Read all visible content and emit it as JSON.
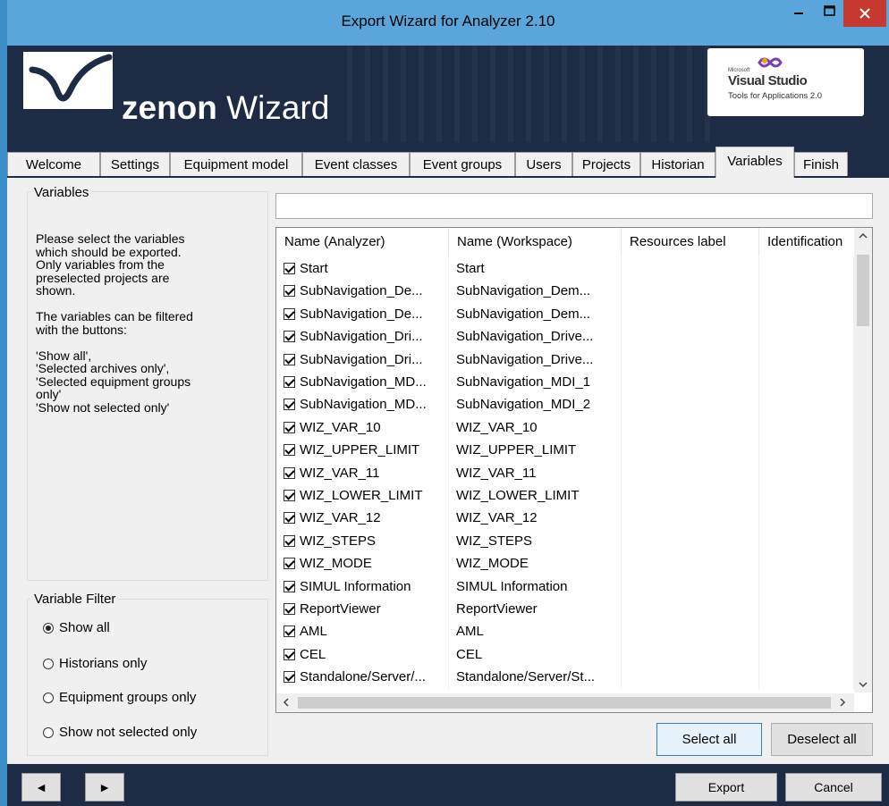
{
  "window": {
    "title": "Export Wizard for Analyzer 2.10",
    "controls": {
      "minimize": "–",
      "maximize": "□",
      "close": "✕"
    }
  },
  "banner": {
    "brand_bold": "zenon",
    "brand_rest": " Wizard",
    "vs_microsoft": "Microsoft",
    "vs_title": "Visual Studio",
    "vs_sub": "Tools for Applications 2.0"
  },
  "tabs": [
    {
      "label": "Welcome"
    },
    {
      "label": "Settings"
    },
    {
      "label": "Equipment model"
    },
    {
      "label": "Event classes"
    },
    {
      "label": "Event groups"
    },
    {
      "label": "Users"
    },
    {
      "label": "Projects"
    },
    {
      "label": "Historian"
    },
    {
      "label": "Variables",
      "active": true
    },
    {
      "label": "Finish"
    }
  ],
  "left": {
    "variables_legend": "Variables",
    "description": "Please select the variables\nwhich should be exported.\nOnly variables from the\npreselected projects are\nshown.\n\nThe variables can be filtered\nwith the buttons:\n\n'Show all',\n'Selected archives only',\n'Selected equipment groups\nonly'\n'Show not selected only'",
    "filter_legend": "Variable Filter",
    "filter_options": [
      {
        "label": "Show all",
        "checked": true
      },
      {
        "label": "Historians only",
        "checked": false
      },
      {
        "label": "Equipment groups only",
        "checked": false
      },
      {
        "label": "Show not selected only",
        "checked": false
      }
    ]
  },
  "filter_input": {
    "value": ""
  },
  "table": {
    "columns": [
      "Name (Analyzer)",
      "Name (Workspace)",
      "Resources label",
      "Identification"
    ],
    "rows": [
      {
        "checked": true,
        "analyzer": "Start",
        "workspace": "Start"
      },
      {
        "checked": true,
        "analyzer": "SubNavigation_De...",
        "workspace": "SubNavigation_Dem..."
      },
      {
        "checked": true,
        "analyzer": "SubNavigation_De...",
        "workspace": "SubNavigation_Dem..."
      },
      {
        "checked": true,
        "analyzer": "SubNavigation_Dri...",
        "workspace": "SubNavigation_Drive..."
      },
      {
        "checked": true,
        "analyzer": "SubNavigation_Dri...",
        "workspace": "SubNavigation_Drive..."
      },
      {
        "checked": true,
        "analyzer": "SubNavigation_MD...",
        "workspace": "SubNavigation_MDI_1"
      },
      {
        "checked": true,
        "analyzer": "SubNavigation_MD...",
        "workspace": "SubNavigation_MDI_2"
      },
      {
        "checked": true,
        "analyzer": "WIZ_VAR_10",
        "workspace": "WIZ_VAR_10"
      },
      {
        "checked": true,
        "analyzer": "WIZ_UPPER_LIMIT",
        "workspace": "WIZ_UPPER_LIMIT"
      },
      {
        "checked": true,
        "analyzer": "WIZ_VAR_11",
        "workspace": "WIZ_VAR_11"
      },
      {
        "checked": true,
        "analyzer": "WIZ_LOWER_LIMIT",
        "workspace": "WIZ_LOWER_LIMIT"
      },
      {
        "checked": true,
        "analyzer": "WIZ_VAR_12",
        "workspace": "WIZ_VAR_12"
      },
      {
        "checked": true,
        "analyzer": "WIZ_STEPS",
        "workspace": "WIZ_STEPS"
      },
      {
        "checked": true,
        "analyzer": "WIZ_MODE",
        "workspace": "WIZ_MODE"
      },
      {
        "checked": true,
        "analyzer": "SIMUL Information",
        "workspace": "SIMUL Information"
      },
      {
        "checked": true,
        "analyzer": "ReportViewer",
        "workspace": "ReportViewer"
      },
      {
        "checked": true,
        "analyzer": "AML",
        "workspace": "AML"
      },
      {
        "checked": true,
        "analyzer": "CEL",
        "workspace": "CEL"
      },
      {
        "checked": true,
        "analyzer": "Standalone/Server/...",
        "workspace": "Standalone/Server/St..."
      }
    ]
  },
  "buttons": {
    "select_all": "Select all",
    "deselect_all": "Deselect all",
    "back": "◄",
    "forward": "►",
    "export": "Export",
    "cancel": "Cancel"
  },
  "colors": {
    "title_bar": "#5aa5d9",
    "banner": "#1d2c44",
    "close": "#c7382e"
  }
}
